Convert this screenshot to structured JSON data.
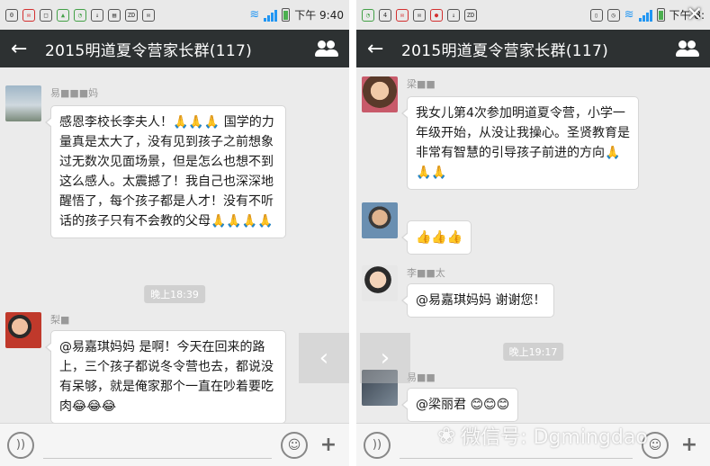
{
  "left_screen": {
    "status_time": "下午 9:40",
    "title": "2015明道夏令营家长群(117)",
    "messages": [
      {
        "sender": "易■■■妈",
        "text": "感恩李校长李夫人！🙏🙏🙏 国学的力量真是太大了，没有见到孩子之前想象过无数次见面场景，但是怎么也想不到这么感人。太震撼了！我自己也深深地醒悟了，每个孩子都是人才！没有不听话的孩子只有不会教的父母🙏🙏🙏🙏"
      },
      {
        "sender": "梨■",
        "text": "@易嘉琪妈妈 是啊！今天在回来的路上，三个孩子都说冬令营也去，都说没有呆够，就是俺家那个一直在吵着要吃肉😂😂😂"
      }
    ],
    "timestamp": "晚上18:39"
  },
  "right_screen": {
    "status_time": "下午 8:",
    "title": "2015明道夏令营家长群(117)",
    "messages": [
      {
        "sender": "梁■■",
        "text": "我女儿第4次参加明道夏令营，小学一年级开始，从没让我操心。圣贤教育是非常有智慧的引导孩子前进的方向🙏🙏🙏"
      },
      {
        "sender": "",
        "text": "👍👍👍"
      },
      {
        "sender": "李■■太",
        "text": "@易嘉琪妈妈 谢谢您！"
      },
      {
        "sender": "易■■",
        "text": "@梁丽君 😊😊😊"
      }
    ],
    "timestamp": "晚上19:17"
  },
  "watermark": "微信号: Dgmingdao",
  "icons": {
    "back": "back-arrow-icon",
    "members": "group-members-icon",
    "voice": "voice-icon",
    "emoji": "emoji-icon",
    "add": "plus-icon",
    "close": "close-icon"
  }
}
